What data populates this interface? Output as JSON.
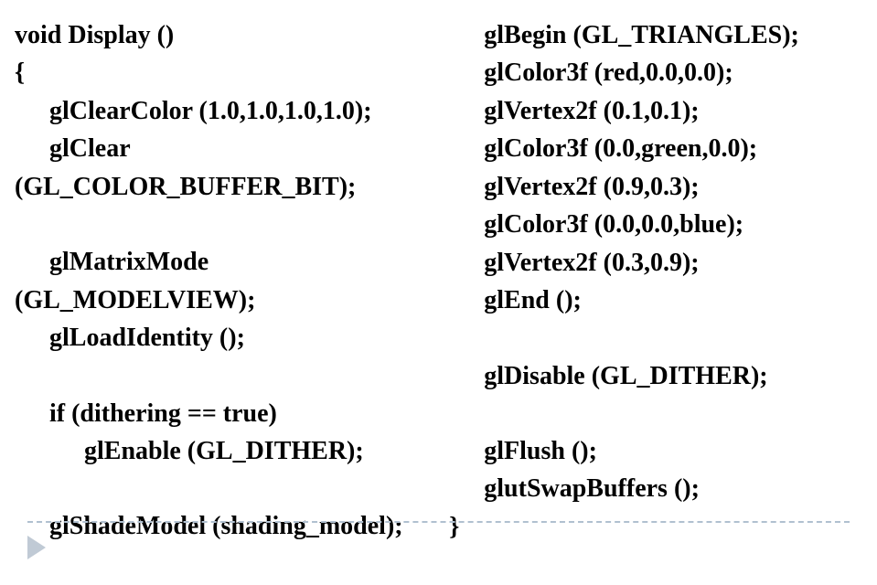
{
  "left": {
    "l1": "void Display ()",
    "l2": "{",
    "l3": "glClearColor (1.0,1.0,1.0,1.0);",
    "l4": "glClear",
    "l5": "(GL_COLOR_BUFFER_BIT);",
    "l6": "glMatrixMode",
    "l7": "(GL_MODELVIEW);",
    "l8": "glLoadIdentity ();",
    "l9": "if (dithering == true)",
    "l10": "glEnable (GL_DITHER);",
    "l11": "glShadeModel (shading_model);"
  },
  "right": {
    "l1": "glBegin (GL_TRIANGLES);",
    "l2": "glColor3f (red,0.0,0.0);",
    "l3": "glVertex2f (0.1,0.1);",
    "l4": "glColor3f (0.0,green,0.0);",
    "l5": "glVertex2f (0.9,0.3);",
    "l6": "glColor3f (0.0,0.0,blue);",
    "l7": "glVertex2f (0.3,0.9);",
    "l8": "glEnd ();",
    "l9": "glDisable (GL_DITHER);",
    "l10": "glFlush ();",
    "l11": "glutSwapBuffers ();",
    "l12": "}"
  }
}
